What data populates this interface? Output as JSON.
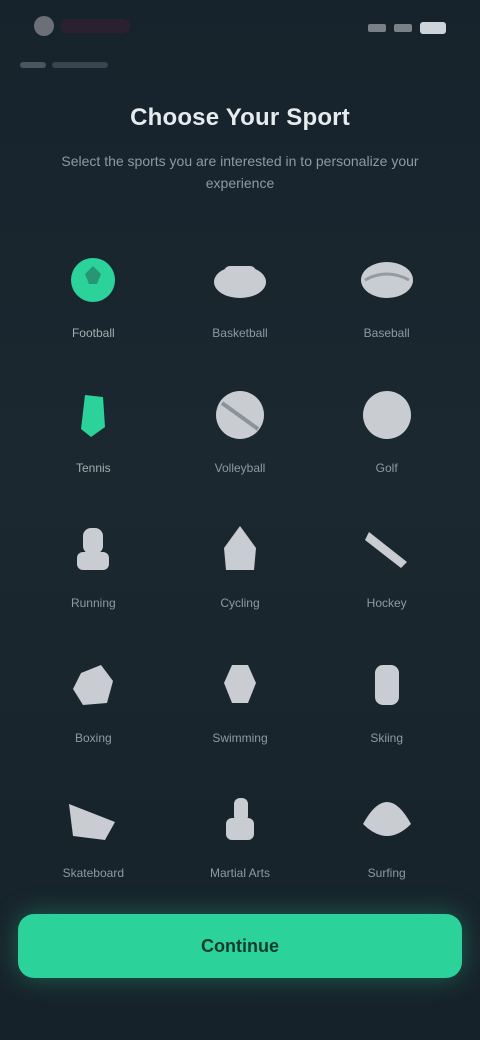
{
  "header": {
    "title": "Choose Your Sport",
    "subtitle": "Select the sports you are interested in to personalize your experience"
  },
  "sports": [
    {
      "label": "Football",
      "icon": "football-icon",
      "selected": true
    },
    {
      "label": "Basketball",
      "icon": "basketball-icon",
      "selected": false
    },
    {
      "label": "Baseball",
      "icon": "baseball-icon",
      "selected": false
    },
    {
      "label": "Tennis",
      "icon": "tennis-icon",
      "selected": true
    },
    {
      "label": "Volleyball",
      "icon": "volleyball-icon",
      "selected": false
    },
    {
      "label": "Golf",
      "icon": "golf-icon",
      "selected": false
    },
    {
      "label": "Running",
      "icon": "running-icon",
      "selected": false
    },
    {
      "label": "Cycling",
      "icon": "cycling-icon",
      "selected": false
    },
    {
      "label": "Hockey",
      "icon": "hockey-icon",
      "selected": false
    },
    {
      "label": "Boxing",
      "icon": "boxing-icon",
      "selected": false
    },
    {
      "label": "Swimming",
      "icon": "swimming-icon",
      "selected": false
    },
    {
      "label": "Skiing",
      "icon": "skiing-icon",
      "selected": false
    },
    {
      "label": "Skateboard",
      "icon": "skateboard-icon",
      "selected": false
    },
    {
      "label": "Martial Arts",
      "icon": "martial-arts-icon",
      "selected": false
    },
    {
      "label": "Surfing",
      "icon": "surfing-icon",
      "selected": false
    }
  ],
  "footer": {
    "continue_label": "Continue"
  },
  "colors": {
    "accent": "#2bd39a",
    "icon_default": "#c9cdd2",
    "background": "#1c2830"
  }
}
